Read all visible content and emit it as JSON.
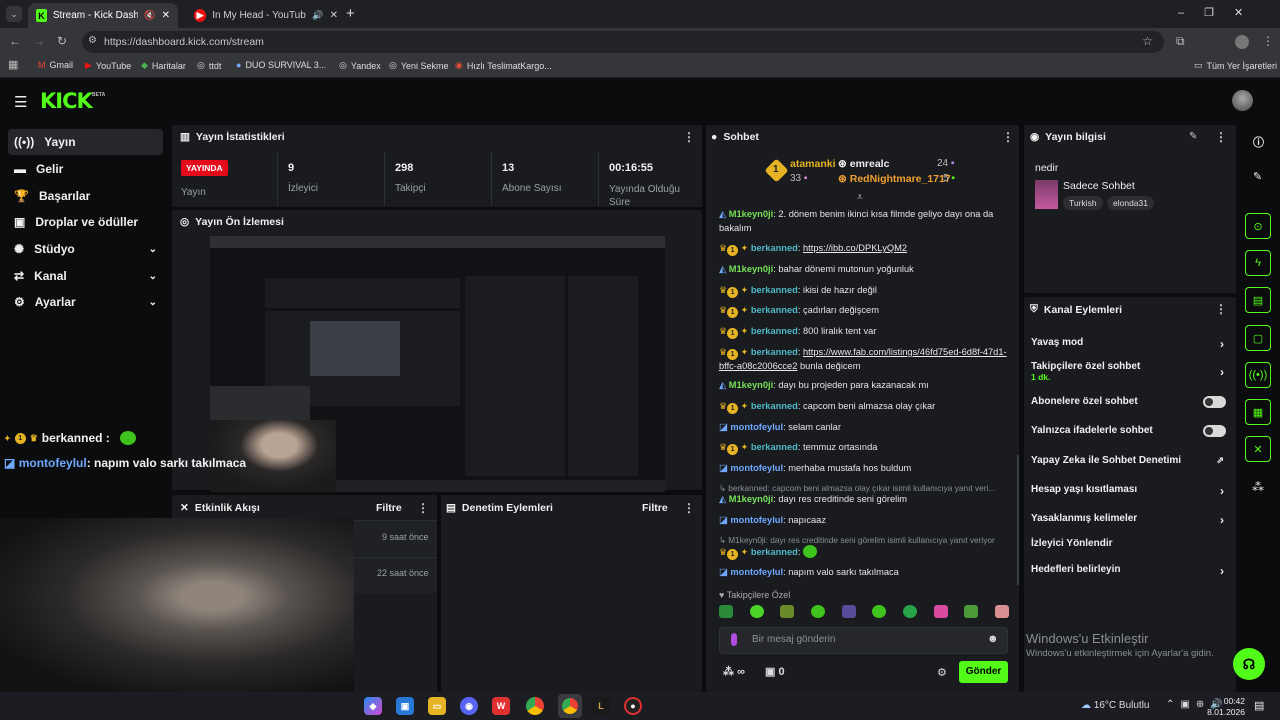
{
  "browser": {
    "tabs": [
      {
        "title": "Stream - Kick Dashboard",
        "active": true
      },
      {
        "title": "In My Head - YouTube Mu",
        "active": false
      }
    ],
    "url": "https://dashboard.kick.com/stream",
    "bookmarks": [
      "Gmail",
      "YouTube",
      "Haritalar",
      "ttdt",
      "DUO SURVIVAL 3...",
      "Yandex",
      "Yeni Sekme",
      "Hızlı TeslimatKargo..."
    ],
    "all_bookmarks": "Tüm Yer İşaretleri"
  },
  "app": {
    "logo": "KICK",
    "logo_beta": "BETA"
  },
  "sidebar": {
    "items": [
      {
        "label": "Yayın",
        "selected": true
      },
      {
        "label": "Gelir"
      },
      {
        "label": "Başarılar"
      },
      {
        "label": "Droplar ve ödüller"
      },
      {
        "label": "Stüdyo"
      },
      {
        "label": "Kanal"
      },
      {
        "label": "Ayarlar"
      }
    ]
  },
  "stats": {
    "title": "Yayın İstatistikleri",
    "live_badge": "YAYINDA",
    "status_label": "Yayın",
    "items": [
      {
        "value": "9",
        "label": "İzleyici"
      },
      {
        "value": "298",
        "label": "Takipçi"
      },
      {
        "value": "13",
        "label": "Abone Sayısı"
      },
      {
        "value": "00:16:55",
        "label": "Yayında Olduğu Süre"
      }
    ]
  },
  "preview": {
    "title": "Yayın Ön İzlemesi"
  },
  "overlay": {
    "line1_user": "berkanned :",
    "line2_user": "montofeylul",
    "line2_text": ": napım valo sarkı takılmaca"
  },
  "activity": {
    "title": "Etkinlik Akışı",
    "filter": "Filtre",
    "times": [
      "9 saat önce",
      "22 saat önce"
    ]
  },
  "moderation": {
    "title": "Denetim Eylemleri",
    "filter": "Filtre"
  },
  "chat": {
    "title": "Sohbet",
    "leaders": [
      {
        "rank": "1",
        "name": "atamanki",
        "count": "33"
      },
      {
        "name": "emrealc",
        "count": "24"
      },
      {
        "name": "RedNightmare_1717",
        "count": "5"
      }
    ],
    "messages": [
      {
        "user": "M1keyn0ji",
        "text": "2. dönem benim ikinci kısa filmde geliyo dayı ona da bakalım"
      },
      {
        "user": "berkanned",
        "text": "https://ibb.co/DPKLyQM2"
      },
      {
        "user": "M1keyn0ji",
        "text": "bahar dönemi mutonun yoğunluk"
      },
      {
        "user": "berkanned",
        "text": "ikisi de hazır değil"
      },
      {
        "user": "berkanned",
        "text": "çadırları değişcem"
      },
      {
        "user": "berkanned",
        "text": "800 liralık tent var"
      },
      {
        "user": "berkanned",
        "text": "https://www.fab.com/listings/46fd75ed-6d8f-47d1-bffc-a08c2006cce2",
        "suffix": " bunla değicem"
      },
      {
        "user": "M1keyn0ji",
        "text": "dayı bu projeden para kazanacak mı"
      },
      {
        "user": "berkanned",
        "text": "capcom beni almazsa olay çıkar"
      },
      {
        "user": "montofeylul",
        "text": "selam canlar"
      },
      {
        "user": "berkanned",
        "text": "temmuz ortasında"
      },
      {
        "user": "montofeylul",
        "text": "merhaba mustafa hos buldum"
      },
      {
        "reply": "berkanned: capcom beni almazsa olay çıkar isimli kullanıcıya yanıt veri...",
        "user": "M1keyn0ji",
        "text": "dayı res creditinde seni görelim"
      },
      {
        "user": "montofeylul",
        "text": "napıcaaz"
      },
      {
        "reply": "M1keyn0ji: dayı res creditinde seni görelim isimli kullanıcıya yanıt veriyor",
        "user": "berkanned",
        "text": ""
      },
      {
        "user": "montofeylul",
        "text": "napım valo sarkı takılmaca"
      }
    ],
    "followers_only": "Takipçilere Özel",
    "placeholder": "Bir mesaj gönderin",
    "points": "∞",
    "gifts": "0",
    "send": "Gönder"
  },
  "stream_info": {
    "title": "Yayın bilgisi",
    "stream_title": "nedir",
    "category": "Sadece Sohbet",
    "tags": [
      "Turkish",
      "elonda31"
    ]
  },
  "channel_actions": {
    "title": "Kanal Eylemleri",
    "items": [
      {
        "label": "Yavaş mod",
        "type": "arrow"
      },
      {
        "label": "Takipçilere özel sohbet",
        "sub": "1 dk.",
        "type": "arrow"
      },
      {
        "label": "Abonelere özel sohbet",
        "type": "toggle"
      },
      {
        "label": "Yalnızca ifadelerle sohbet",
        "type": "toggle"
      },
      {
        "label": "Yapay Zeka ile Sohbet Denetimi",
        "type": "external"
      },
      {
        "label": "Hesap yaşı kısıtlaması",
        "type": "arrow"
      },
      {
        "label": "Yasaklanmış kelimeler",
        "type": "arrow"
      },
      {
        "label": "İzleyici Yönlendir",
        "type": "none"
      },
      {
        "label": "Hedefleri belirleyin",
        "type": "arrow"
      }
    ]
  },
  "watermark": {
    "title": "Windows'u Etkinleştir",
    "sub": "Windows'u etkinleştirmek için Ayarlar'a gidin."
  },
  "taskbar": {
    "weather": "16°C  Bulutlu",
    "time": "00:42",
    "date": "8.01.2026"
  },
  "colors": {
    "accent": "#53fc18",
    "live": "#e5091c",
    "panel": "#191b1f"
  }
}
